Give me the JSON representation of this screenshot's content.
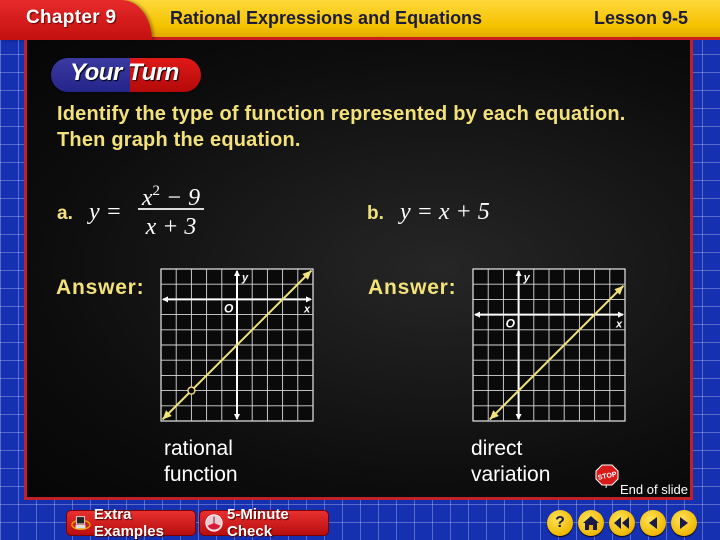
{
  "header": {
    "chapter": "Chapter 9",
    "title": "Rational Expressions and Equations",
    "lesson": "Lesson 9-5"
  },
  "badge": {
    "label": "Your Turn"
  },
  "instructions": "Identify the type of function represented by each equation. Then graph the equation.",
  "parts": [
    {
      "label": "a.",
      "equation_lhs": "y =",
      "numerator": "x² − 9",
      "numerator_base": "x",
      "numerator_exp": "2",
      "numerator_rest": " − 9",
      "denominator": "x + 3",
      "answer_label": "Answer:",
      "answer_line1": "rational",
      "answer_line2": "function",
      "graph": {
        "axis_x_label": "x",
        "axis_y_label": "y",
        "origin_label": "O",
        "x_range": [
          -5,
          5
        ],
        "y_range": [
          -8,
          2
        ],
        "line": {
          "slope": 1,
          "intercept": -3
        },
        "hole": [
          -3,
          -6
        ],
        "line_color": "#f1e27c"
      }
    },
    {
      "label": "b.",
      "equation": "y = x + 5",
      "answer_label": "Answer:",
      "answer_line1": "direct",
      "answer_line2": "variation",
      "graph": {
        "axis_x_label": "x",
        "axis_y_label": "y",
        "origin_label": "O",
        "x_range": [
          -3,
          7
        ],
        "y_range": [
          -7,
          3
        ],
        "line": {
          "slope": 1,
          "intercept": -5
        },
        "line_color": "#f1e27c"
      }
    }
  ],
  "end_slide": {
    "label": "End of slide",
    "icon": "stop-sign-icon",
    "sign_text": "STOP"
  },
  "footer": {
    "extra_examples": "Extra Examples",
    "five_minute_check": "5-Minute Check",
    "help_glyph": "?",
    "buttons": [
      "help",
      "home",
      "first",
      "previous",
      "next"
    ]
  },
  "colors": {
    "header_yellow": "#f5c200",
    "chapter_red": "#d41818",
    "frame_blue": "#1530b0",
    "text_yellow": "#f3e27a",
    "graph_line": "#f1e27c"
  }
}
